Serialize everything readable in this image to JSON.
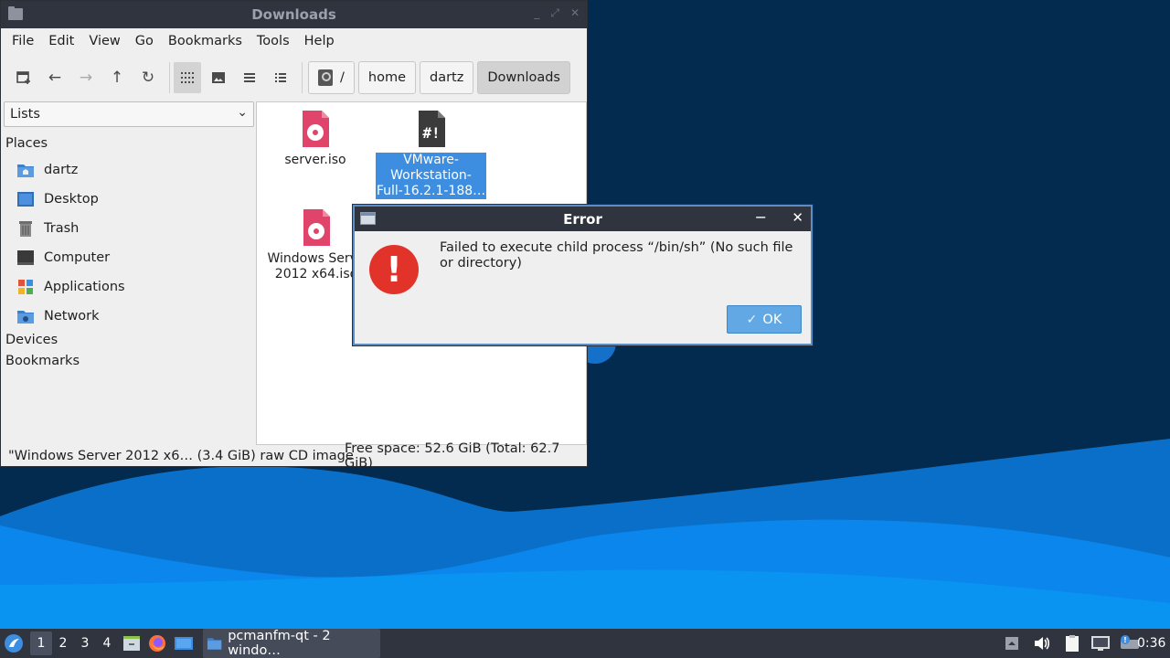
{
  "file_manager": {
    "title": "Downloads",
    "menu": [
      "File",
      "Edit",
      "View",
      "Go",
      "Bookmarks",
      "Tools",
      "Help"
    ],
    "breadcrumbs": {
      "root": "/",
      "home": "home",
      "user": "dartz",
      "current": "Downloads"
    },
    "sidebar": {
      "view_selector": "Lists",
      "places_header": "Places",
      "places": [
        "dartz",
        "Desktop",
        "Trash",
        "Computer",
        "Applications",
        "Network"
      ],
      "devices_header": "Devices",
      "bookmarks_header": "Bookmarks"
    },
    "files": [
      {
        "name": "server.iso"
      },
      {
        "name_lines": [
          "VMware-",
          "Workstation-",
          "Full-16.2.1-188…"
        ]
      },
      {
        "name_lines": [
          "Windows Serve",
          "2012 x64.iso"
        ]
      }
    ],
    "status": {
      "selected_info": "\"Windows Server 2012 x6… (3.4 GiB) raw CD image",
      "free_space": "Free space: 52.6 GiB (Total: 62.7 GiB)"
    }
  },
  "error_dialog": {
    "title": "Error",
    "message": "Failed to execute child process “/bin/sh” (No such file or directory)",
    "ok_label": "OK"
  },
  "taskbar": {
    "workspaces": [
      "1",
      "2",
      "3",
      "4"
    ],
    "active_workspace": "1",
    "window_button": "pcmanfm-qt - 2 windo…",
    "clock": "0:36"
  },
  "colors": {
    "titlebar": "#2f343f",
    "selection": "#3d8de0",
    "error_icon": "#e2332a",
    "ok_button": "#62a8e4",
    "desktop_dark": "#032a4f",
    "desktop_wave": "#0a84e8"
  },
  "icons": {
    "file_iso": "cd-file-icon",
    "file_script": "script-file-icon",
    "error": "error-icon"
  }
}
